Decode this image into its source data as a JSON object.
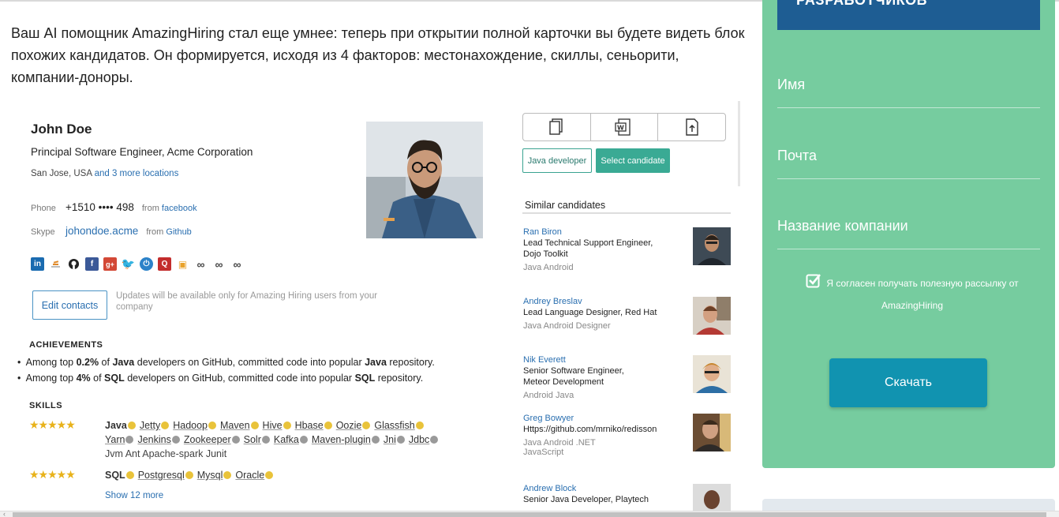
{
  "article": {
    "intro": "Ваш AI помощник AmazingHiring стал еще умнее: теперь при открытии полной карточки вы будете видеть блок похожих кандидатов. Он формируется, исходя из 4 факторов: местонахождение, скиллы, сеньорити, компании-доноры."
  },
  "profile": {
    "name": "John Doe",
    "position": "Principal Software Engineer, Acme Corporation",
    "location": "San Jose, USA",
    "location_more": "and 3 more locations",
    "phone_label": "Phone",
    "phone_value": "+1510 •••• 498",
    "phone_source_prefix": "from",
    "phone_source": "facebook",
    "skype_label": "Skype",
    "skype_value": "johondoe.acme",
    "skype_source_prefix": "from",
    "skype_source": "Github",
    "socials": [
      "linkedin-icon",
      "stackoverflow-icon",
      "github-icon",
      "facebook-icon",
      "googleplus-icon",
      "twitter-icon",
      "power-icon",
      "quora-icon",
      "badge-icon",
      "link-icon",
      "link-icon",
      "link-icon"
    ],
    "edit_contacts": "Edit contacts",
    "edit_note": "Updates will be available only for Amazing Hiring users from your company",
    "achievements_title": "ACHIEVEMENTS",
    "achievements": [
      {
        "pre": "Among top ",
        "pct": "0.2%",
        "mid": " of ",
        "lang": "Java",
        "post": " developers on GitHub, committed code into popular ",
        "lang2": "Java",
        "end": " repository."
      },
      {
        "pre": "Among top ",
        "pct": "4%",
        "mid": " of ",
        "lang": "SQL",
        "post": " developers on GitHub, committed code into popular ",
        "lang2": "SQL",
        "end": " repository."
      }
    ],
    "skills_title": "SKILLS",
    "skills_rating": "★★★★★",
    "skills_java_line1": [
      "Java",
      "Jetty",
      "Hadoop",
      "Maven",
      "Hive",
      "Hbase",
      "Oozie",
      "Glassfish"
    ],
    "skills_java_line2": [
      "Yarn",
      "Jenkins",
      "Zookeeper",
      "Solr",
      "Kafka",
      "Maven-plugin",
      "Jni",
      "Jdbc"
    ],
    "skills_java_line3": "Jvm  Ant  Apache-spark  Junit",
    "skills_sql_line": [
      "SQL",
      "Postgresql",
      "Mysql",
      "Oracle"
    ],
    "show_more": "Show 12 more"
  },
  "actions": {
    "tag_java": "Java developer",
    "select_candidate": "Select candidate"
  },
  "similar": {
    "title": "Similar candidates",
    "candidates": [
      {
        "name": "Ran Biron",
        "title": "Lead Technical Support Engineer,\nDojo Toolkit",
        "skills": "Java  Android"
      },
      {
        "name": "Andrey Breslav",
        "title": "Lead Language Designer, Red Hat",
        "skills": "Java  Android  Designer"
      },
      {
        "name": "Nik Everett",
        "title": "Senior Software Engineer,\nMeteor Development",
        "skills": "Android  Java"
      },
      {
        "name": "Greg Bowyer",
        "title": "Https://github.com/mrniko/redisson",
        "skills": "Java  Android  .NET\nJavaScript"
      },
      {
        "name": "Andrew Block",
        "title": "Senior Java Developer, Playtech",
        "skills": ""
      }
    ]
  },
  "sidebar": {
    "header": "РАЗРАБОТЧИКОВ",
    "field_name": "Имя",
    "field_email": "Почта",
    "field_company": "Название компании",
    "consent_line1": "Я согласен получать полезную рассылку от",
    "consent_line2": "AmazingHiring",
    "download": "Скачать",
    "colors": {
      "panel": "#76cc9f",
      "header": "#1e5d93",
      "button": "#1193b0"
    }
  }
}
